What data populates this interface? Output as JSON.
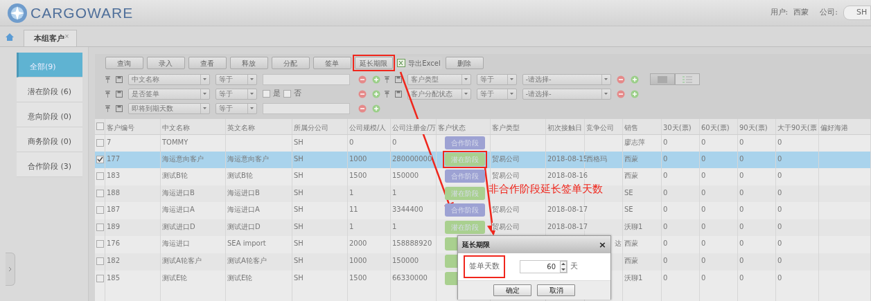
{
  "header": {
    "logo_text": "CARGOWARE",
    "user_label": "用户:",
    "user": "西蒙",
    "company_label": "公司:",
    "company": "SH"
  },
  "tabs": [
    {
      "label": "本组客户",
      "close": "×",
      "selected": true
    }
  ],
  "sidebar": {
    "items": [
      {
        "label": "全部(9)",
        "selected": true
      },
      {
        "label": "潜在阶段 (6)",
        "selected": false
      },
      {
        "label": "意向阶段 (0)",
        "selected": false
      },
      {
        "label": "商务阶段 (0)",
        "selected": false
      },
      {
        "label": "合作阶段 (3)",
        "selected": false
      }
    ]
  },
  "toolbar": {
    "buttons": [
      {
        "label": "查询",
        "kind": "plain"
      },
      {
        "label": "录入",
        "kind": "plain"
      },
      {
        "label": "查看",
        "kind": "plain"
      },
      {
        "label": "释放",
        "kind": "plain"
      },
      {
        "label": "分配",
        "kind": "plain"
      },
      {
        "label": "签单",
        "kind": "plain"
      },
      {
        "label": "延长期限",
        "kind": "plain"
      },
      {
        "label": "导出Excel",
        "kind": "export"
      },
      {
        "label": "删除",
        "kind": "plain"
      }
    ]
  },
  "filters": {
    "left": [
      {
        "field": "中文名称",
        "operator": "等于",
        "kind": "text"
      },
      {
        "field": "是否签单",
        "operator": "等于",
        "kind": "checks",
        "options": [
          {
            "label": "是",
            "checked": false
          },
          {
            "label": "否",
            "checked": false
          }
        ]
      },
      {
        "field": "即将到期天数",
        "operator": "等于",
        "kind": "text"
      }
    ],
    "right": [
      {
        "field": "客户类型",
        "operator": "等于",
        "value": "-请选择-"
      },
      {
        "field": "客户分配状态",
        "operator": "等于",
        "value": "-请选择-"
      }
    ],
    "view_modes": [
      {
        "kind": "grid",
        "selected": true
      },
      {
        "kind": "list",
        "selected": false
      }
    ]
  },
  "table": {
    "all_selected": false,
    "columns": [
      "客户编号",
      "中文名称",
      "英文名称",
      "所属分公司",
      "公司规模/人",
      "公司注册金/万",
      "客户状态",
      "客户类型",
      "初次接触日",
      "竞争公司",
      "销售",
      "30天(票)",
      "60天(票)",
      "90天(票)",
      "大于90天(票",
      "偏好海港"
    ],
    "rows": [
      {
        "selected": false,
        "id": "7",
        "cn": "TOMMY",
        "branch": "SH",
        "size": "0",
        "capital": "0",
        "status": {
          "kind": "cooperation",
          "label": "合作阶段"
        },
        "sales": "廖志萍",
        "d30": "0",
        "d60": "0",
        "d90": "0",
        "d90plus": "0"
      },
      {
        "selected": true,
        "id": "177",
        "cn": "海运意向客户",
        "en": "海运意向客户",
        "branch": "SH",
        "size": "1000",
        "capital": "280000000",
        "status": {
          "kind": "potential",
          "label": "潜在阶段"
        },
        "type": "贸易公司",
        "first_contact": "2018-08-15",
        "competitor": "西格玛",
        "sales": "西蒙",
        "d30": "0",
        "d60": "0",
        "d90": "0",
        "d90plus": "0"
      },
      {
        "selected": false,
        "id": "183",
        "cn": "测试B轮",
        "en": "测试B轮",
        "branch": "SH",
        "size": "1500",
        "capital": "150000",
        "status": {
          "kind": "cooperation",
          "label": "合作阶段"
        },
        "type": "贸易公司",
        "first_contact": "2018-08-16",
        "sales": "西蒙",
        "d30": "0",
        "d60": "0",
        "d90": "0",
        "d90plus": "0"
      },
      {
        "selected": false,
        "id": "188",
        "cn": "海运进口B",
        "en": "海运进口B",
        "branch": "SH",
        "size": "1",
        "capital": "1",
        "status": {
          "kind": "potential",
          "label": "潜在阶段"
        },
        "sales": "SE",
        "d30": "0",
        "d60": "0",
        "d90": "0",
        "d90plus": "0"
      },
      {
        "selected": false,
        "id": "187",
        "cn": "海运进口A",
        "en": "海运进口A",
        "branch": "SH",
        "size": "11",
        "capital": "3344400",
        "status": {
          "kind": "cooperation",
          "label": "合作阶段"
        },
        "type": "贸易公司",
        "first_contact": "2018-08-17",
        "sales": "SE",
        "d30": "0",
        "d60": "0",
        "d90": "0",
        "d90plus": "0"
      },
      {
        "selected": false,
        "id": "189",
        "cn": "测试进口D",
        "en": "测试进口D",
        "branch": "SH",
        "size": "1",
        "capital": "1",
        "status": {
          "kind": "potential",
          "label": "潜在阶段"
        },
        "type": "贸易公司",
        "first_contact": "2018-08-17",
        "sales": "沃聊1",
        "d30": "0",
        "d60": "0",
        "d90": "0",
        "d90plus": "0"
      },
      {
        "selected": false,
        "id": "176",
        "cn": "海运进口",
        "en": "SEA import",
        "branch": "SH",
        "size": "2000",
        "capital": "158888920",
        "status": {
          "kind": "potential"
        },
        "competitor": "达",
        "sales": "西蒙",
        "d30": "0",
        "d60": "0",
        "d90": "0",
        "d90plus": "0"
      },
      {
        "selected": false,
        "id": "182",
        "cn": "测试A轮客户",
        "en": "测试A轮客户",
        "branch": "SH",
        "size": "1000",
        "capital": "150000",
        "status": {
          "kind": "potential"
        },
        "sales": "西蒙",
        "d30": "0",
        "d60": "0",
        "d90": "0",
        "d90plus": "0"
      },
      {
        "selected": false,
        "id": "185",
        "cn": "测试E轮",
        "en": "测试E轮",
        "branch": "SH",
        "size": "1500",
        "capital": "66330000",
        "status": {
          "kind": "potential"
        },
        "sales": "沃聊1",
        "d30": "0",
        "d60": "0",
        "d90": "0",
        "d90plus": "0"
      }
    ]
  },
  "dialog": {
    "title": "延长期限",
    "close": "×",
    "label": "签单天数",
    "value": "60",
    "unit": "天",
    "buttons": [
      "确定",
      "取消"
    ]
  },
  "annotation": {
    "text": "非合作阶段延长签单天数"
  }
}
